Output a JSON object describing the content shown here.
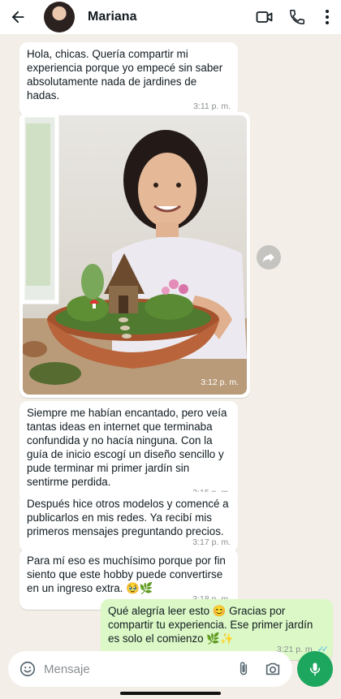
{
  "header": {
    "contact_name": "Mariana",
    "icons": [
      "back-arrow-icon",
      "video-call-icon",
      "phone-icon",
      "more-options-icon"
    ]
  },
  "messages": [
    {
      "type": "text",
      "direction": "incoming",
      "text": "Hola, chicas. Quería compartir mi experiencia porque yo empecé sin saber absolutamente nada de jardines de hadas.",
      "time": "3:11 p. m."
    },
    {
      "type": "image",
      "direction": "incoming",
      "image_description": "Woman smiling holding a terracotta bowl fairy garden with a tiny house",
      "time": "3:12 p. m."
    },
    {
      "type": "text",
      "direction": "incoming",
      "text": "Siempre me habían encantado, pero veía tantas ideas en internet que terminaba confundida y no hacía ninguna. Con la guía de inicio escogí un diseño sencillo y pude terminar mi primer jardín sin sentirme perdida.",
      "time": "3:15 p. m."
    },
    {
      "type": "text",
      "direction": "incoming",
      "text": "Después hice otros modelos y comencé a publicarlos en mis redes. Ya recibí mis primeros mensajes preguntando precios.",
      "time": "3:17 p. m."
    },
    {
      "type": "text",
      "direction": "incoming",
      "text": "Para mí eso es muchísimo porque por fin siento que este hobby puede convertirse en un ingreso extra. 🥹🌿",
      "time": "3:18 p. m."
    },
    {
      "type": "text",
      "direction": "outgoing",
      "text": "Qué alegría leer esto 😊 Gracias por compartir tu experiencia. Ese primer jardín es solo el comienzo 🌿✨",
      "time": "3:21 p. m.",
      "ticks": "✓✓"
    }
  ],
  "composer": {
    "placeholder": "Mensaje",
    "icons": [
      "emoji-icon",
      "attach-icon",
      "camera-icon",
      "mic-icon"
    ]
  },
  "colors": {
    "background": "#f3efe8",
    "incoming_bubble": "#ffffff",
    "outgoing_bubble": "#dcf8c6",
    "mic_button": "#1da65e",
    "read_ticks": "#53bdeb"
  }
}
